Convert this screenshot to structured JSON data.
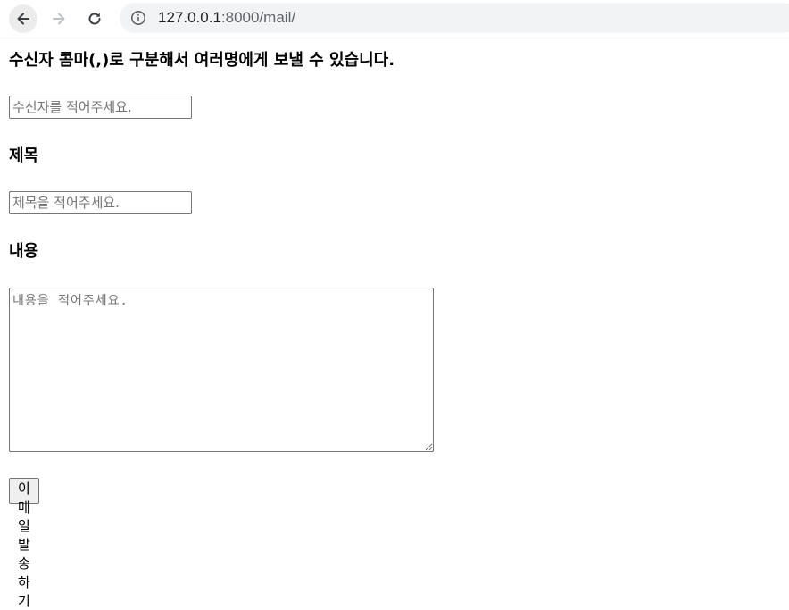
{
  "browser": {
    "url_host": "127.0.0.1",
    "url_rest": ":8000/mail/"
  },
  "form": {
    "recipients_label": "수신자 콤마(,)로 구분해서 여러명에게 보낼 수 있습니다.",
    "recipients_placeholder": "수신자를 적어주세요.",
    "subject_label": "제목",
    "subject_placeholder": "제목을 적어주세요.",
    "body_label": "내용",
    "body_placeholder": "내용을 적어주세요.",
    "send_button": "이메일 발송하기"
  }
}
